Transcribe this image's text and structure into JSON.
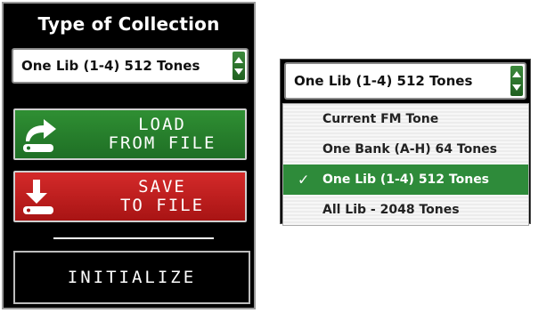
{
  "left_panel": {
    "title": "Type of Collection",
    "collection_select": {
      "value": "One Lib (1-4) 512 Tones"
    },
    "load_button": {
      "label": "LOAD\nFROM FILE",
      "color": "#2a8a2f"
    },
    "save_button": {
      "label": "SAVE\nTO FILE",
      "color": "#c81f1f"
    },
    "initialize_button": {
      "label": "INITIALIZE"
    }
  },
  "dropdown": {
    "value": "One Lib (1-4) 512 Tones",
    "options": [
      {
        "label": "Current FM Tone",
        "selected": false
      },
      {
        "label": "One Bank (A-H) 64 Tones",
        "selected": false
      },
      {
        "label": "One Lib (1-4) 512 Tones",
        "selected": true
      },
      {
        "label": "All Lib - 2048 Tones",
        "selected": false
      }
    ],
    "check_mark": "✓",
    "selected_color": "#2e8b3a"
  }
}
